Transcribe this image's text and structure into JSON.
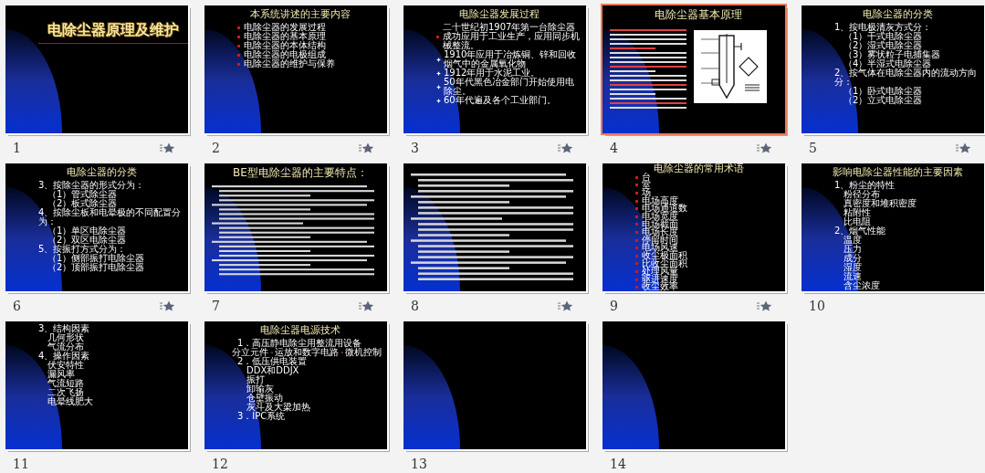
{
  "slides": [
    {
      "number": "1",
      "kind": "title",
      "title": "电除尘器原理及维护",
      "title_rule": true,
      "animated": true,
      "selected": false
    },
    {
      "number": "2",
      "kind": "list",
      "title": "本系统讲述的主要内容",
      "animated": true,
      "selected": false,
      "items": [
        {
          "text": "电除尘器的发展过程",
          "kind": "square"
        },
        {
          "text": "电除尘器的基本原理",
          "kind": "square"
        },
        {
          "text": "电除尘器的本体结构",
          "kind": "square"
        },
        {
          "text": "电除尘器的电极组成",
          "kind": "square"
        },
        {
          "text": "电除尘器的维护与保养",
          "kind": "square"
        }
      ]
    },
    {
      "number": "3",
      "kind": "list",
      "title": "电除尘器发展过程",
      "animated": true,
      "selected": false,
      "items": [
        {
          "text": "二十世纪初1907年第一台除尘器成功应用于工业生产，应用同步机械整流。",
          "kind": "square"
        },
        {
          "text": "1910年应用于冶炼铜、锌和回收烟气中的金属氧化物",
          "kind": "diamond"
        },
        {
          "text": "1912年用于水泥工业。",
          "kind": "diamond"
        },
        {
          "text": "50年代黑色冶金部门开始使用电除尘。",
          "kind": "diamond"
        },
        {
          "text": "60年代遍及各个工业部门。",
          "kind": "diamond"
        }
      ]
    },
    {
      "number": "4",
      "kind": "diagram",
      "title": "电除尘器基本原理",
      "animated": true,
      "selected": true
    },
    {
      "number": "5",
      "kind": "list",
      "title": "电除尘器的分类",
      "animated": true,
      "selected": false,
      "items": [
        {
          "text": "1、按电极清灰方式分：",
          "children": [
            {
              "text": "（1）干式电除尘器"
            },
            {
              "text": "（2）湿式电除尘器"
            },
            {
              "text": "（3）雾状粒子电捕集器"
            },
            {
              "text": "（4）半湿式电除尘器"
            }
          ]
        },
        {
          "text": "2、按气体在电除尘器内的流动方向分：",
          "children": [
            {
              "text": "（1）卧式电除尘器"
            },
            {
              "text": "（2）立式电除尘器"
            }
          ]
        }
      ]
    },
    {
      "number": "6",
      "kind": "list",
      "title": "电除尘器的分类",
      "animated": true,
      "selected": false,
      "items": [
        {
          "text": "3、按除尘器的形式分为：",
          "children": [
            {
              "text": "（1）管式除尘器"
            },
            {
              "text": "（2）板式除尘器"
            }
          ]
        },
        {
          "text": "4、按除尘板和电晕极的不同配置分为：",
          "children": [
            {
              "text": "（1）单区电除尘器"
            },
            {
              "text": "（2）双区电除尘器"
            }
          ]
        },
        {
          "text": "5、按振打方式分为：",
          "children": [
            {
              "text": "（1）侧部振打电除尘器"
            },
            {
              "text": "（2）顶部振打电除尘器"
            }
          ]
        }
      ]
    },
    {
      "number": "7",
      "kind": "dense",
      "title": "BE型电除尘器的主要特点：",
      "animated": true,
      "selected": false
    },
    {
      "number": "8",
      "kind": "dense",
      "animated": true,
      "selected": false
    },
    {
      "number": "9",
      "kind": "list",
      "title": "电除尘器的常用术语",
      "animated": true,
      "selected": false,
      "items": [
        {
          "text": "台",
          "kind": "square"
        },
        {
          "text": "室",
          "kind": "square"
        },
        {
          "text": "场",
          "kind": "square"
        },
        {
          "text": "电场高度",
          "kind": "square"
        },
        {
          "text": "电场通道数",
          "kind": "square"
        },
        {
          "text": "电场宽度",
          "kind": "square"
        },
        {
          "text": "电场截面",
          "kind": "square"
        },
        {
          "text": "电场长度",
          "kind": "square"
        },
        {
          "text": "停留时间",
          "kind": "square"
        },
        {
          "text": "电场风速",
          "kind": "square"
        },
        {
          "text": "收尘极面积",
          "kind": "square"
        },
        {
          "text": "比收尘面积",
          "kind": "square"
        },
        {
          "text": "处理风量",
          "kind": "square"
        },
        {
          "text": "驱进速度",
          "kind": "square"
        },
        {
          "text": "收尘效率",
          "kind": "square"
        }
      ]
    },
    {
      "number": "10",
      "kind": "list",
      "title": "影响电除尘器性能的主要因素",
      "animated": false,
      "selected": false,
      "items": [
        {
          "text": "1、粉尘的特性",
          "children": [
            {
              "text": "粉径分布"
            },
            {
              "text": "真密度和堆积密度"
            },
            {
              "text": "粘附性"
            },
            {
              "text": "比电阻"
            }
          ]
        },
        {
          "text": "2、烟气性能",
          "children": [
            {
              "text": "温度"
            },
            {
              "text": "压力"
            },
            {
              "text": "成分"
            },
            {
              "text": "湿度"
            },
            {
              "text": "流速"
            },
            {
              "text": "含尘浓度"
            }
          ]
        }
      ]
    },
    {
      "number": "11",
      "kind": "list",
      "animated": false,
      "selected": false,
      "items": [
        {
          "text": "3、结构因素",
          "children": [
            {
              "text": "几何形状"
            },
            {
              "text": "气流分布"
            }
          ]
        },
        {
          "text": "4、操作因素",
          "children": [
            {
              "text": "伏安特性"
            },
            {
              "text": "漏风率"
            },
            {
              "text": "气流短路"
            },
            {
              "text": "二次飞扬"
            },
            {
              "text": "电晕线肥大"
            }
          ]
        }
      ]
    },
    {
      "number": "12",
      "kind": "list",
      "title": "电除尘器电源技术",
      "animated": false,
      "selected": false,
      "items": [
        {
          "text": "1．高压静电除尘用整流用设备"
        },
        {
          "kind": "flow",
          "parts": [
            "分立元件",
            "运放和数字电路",
            "微机控制"
          ]
        },
        {
          "text": "2．低压供电装置",
          "children": [
            {
              "text": "DDX和DDJX"
            },
            {
              "text": "振打"
            },
            {
              "text": "卸输灰"
            },
            {
              "text": "仓壁振动"
            },
            {
              "text": "灰斗及大梁加热"
            }
          ]
        },
        {
          "text": "3．IPC系统"
        }
      ]
    },
    {
      "number": "13",
      "kind": "blank",
      "animated": false,
      "selected": false
    },
    {
      "number": "14",
      "kind": "blank",
      "animated": false,
      "selected": false
    }
  ]
}
